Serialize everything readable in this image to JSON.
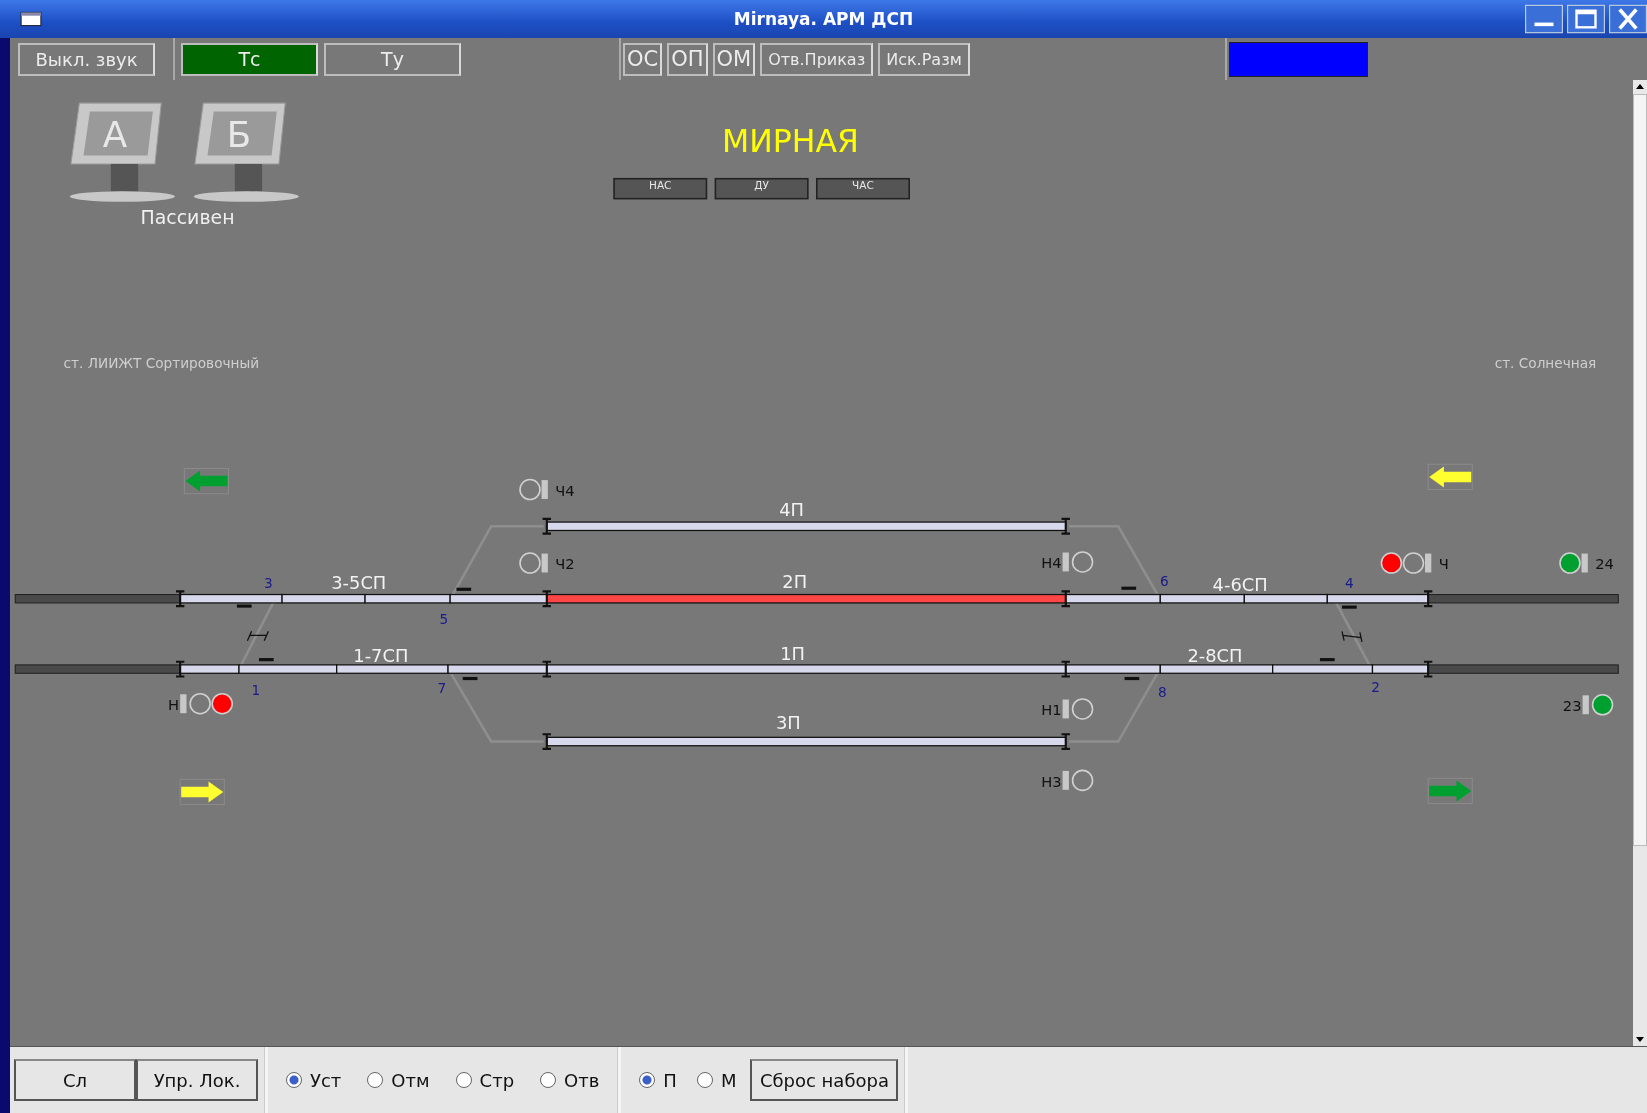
{
  "window": {
    "title": "Mirnaya. АРМ ДСП"
  },
  "toolbar": {
    "sound_button": "Выкл. звук",
    "modes": [
      {
        "label": "Тс",
        "selected": true
      },
      {
        "label": "Ту",
        "selected": false
      }
    ],
    "commands": [
      "ОС",
      "ОП",
      "ОМ",
      "Отв.Приказ",
      "Иск.Разм"
    ]
  },
  "workstations": {
    "monitors": [
      {
        "label": "А"
      },
      {
        "label": "Б"
      }
    ],
    "status": "Пассивен"
  },
  "station": {
    "name": "МИРНАЯ",
    "buttons": [
      "НАС",
      "ДУ",
      "ЧАС"
    ]
  },
  "neighbors": {
    "left": "ст. ЛИИЖТ Сортировочный",
    "right": "ст. Солнечная"
  },
  "tracks": [
    {
      "label": "4П",
      "occupied": false
    },
    {
      "label": "3-5СП",
      "occupied": false
    },
    {
      "label": "2П",
      "occupied": true
    },
    {
      "label": "4-6СП",
      "occupied": false
    },
    {
      "label": "1-7СП",
      "occupied": false
    },
    {
      "label": "1П",
      "occupied": false
    },
    {
      "label": "2-8СП",
      "occupied": false
    },
    {
      "label": "3П",
      "occupied": false
    }
  ],
  "switches": [
    "3",
    "5",
    "1",
    "7",
    "6",
    "4",
    "8",
    "2"
  ],
  "signals": [
    {
      "name": "Ч4",
      "kind": "lamps-left",
      "lamps": [
        {
          "lit": false
        }
      ]
    },
    {
      "name": "Ч2",
      "kind": "lamps-left",
      "lamps": [
        {
          "lit": false
        }
      ]
    },
    {
      "name": "Н",
      "kind": "lamps-right",
      "lamps": [
        {
          "lit": false
        },
        {
          "lit": true,
          "color": "#ff0000"
        }
      ]
    },
    {
      "name": "Н4",
      "kind": "lamps-right",
      "lamps": [
        {
          "lit": false
        }
      ]
    },
    {
      "name": "Н1",
      "kind": "lamps-right",
      "lamps": [
        {
          "lit": false
        }
      ]
    },
    {
      "name": "Н3",
      "kind": "lamps-right",
      "lamps": [
        {
          "lit": false
        }
      ]
    },
    {
      "name": "Ч",
      "kind": "lamps-left",
      "lamps": [
        {
          "lit": true,
          "color": "#ff0000"
        },
        {
          "lit": false
        }
      ]
    },
    {
      "name": "24",
      "kind": "lamps-left",
      "lamps": [
        {
          "lit": true,
          "color": "#00a030"
        }
      ]
    },
    {
      "name": "23",
      "kind": "lamps-right",
      "lamps": [
        {
          "lit": true,
          "color": "#00a030"
        }
      ]
    }
  ],
  "arrows": [
    {
      "kind": "left",
      "color": "#00a030"
    },
    {
      "kind": "right",
      "color": "#ffff30"
    },
    {
      "kind": "left",
      "color": "#ffff30"
    },
    {
      "kind": "right",
      "color": "#00a030"
    }
  ],
  "bottom": {
    "buttons": [
      "Сл",
      "Упр. Лок."
    ],
    "actions": [
      {
        "label": "Уст",
        "selected": true
      },
      {
        "label": "Отм",
        "selected": false
      },
      {
        "label": "Стр",
        "selected": false
      },
      {
        "label": "Отв",
        "selected": false
      }
    ],
    "routes": [
      {
        "label": "П",
        "selected": true
      },
      {
        "label": "М",
        "selected": false
      }
    ],
    "reset_button": "Сброс набора"
  }
}
